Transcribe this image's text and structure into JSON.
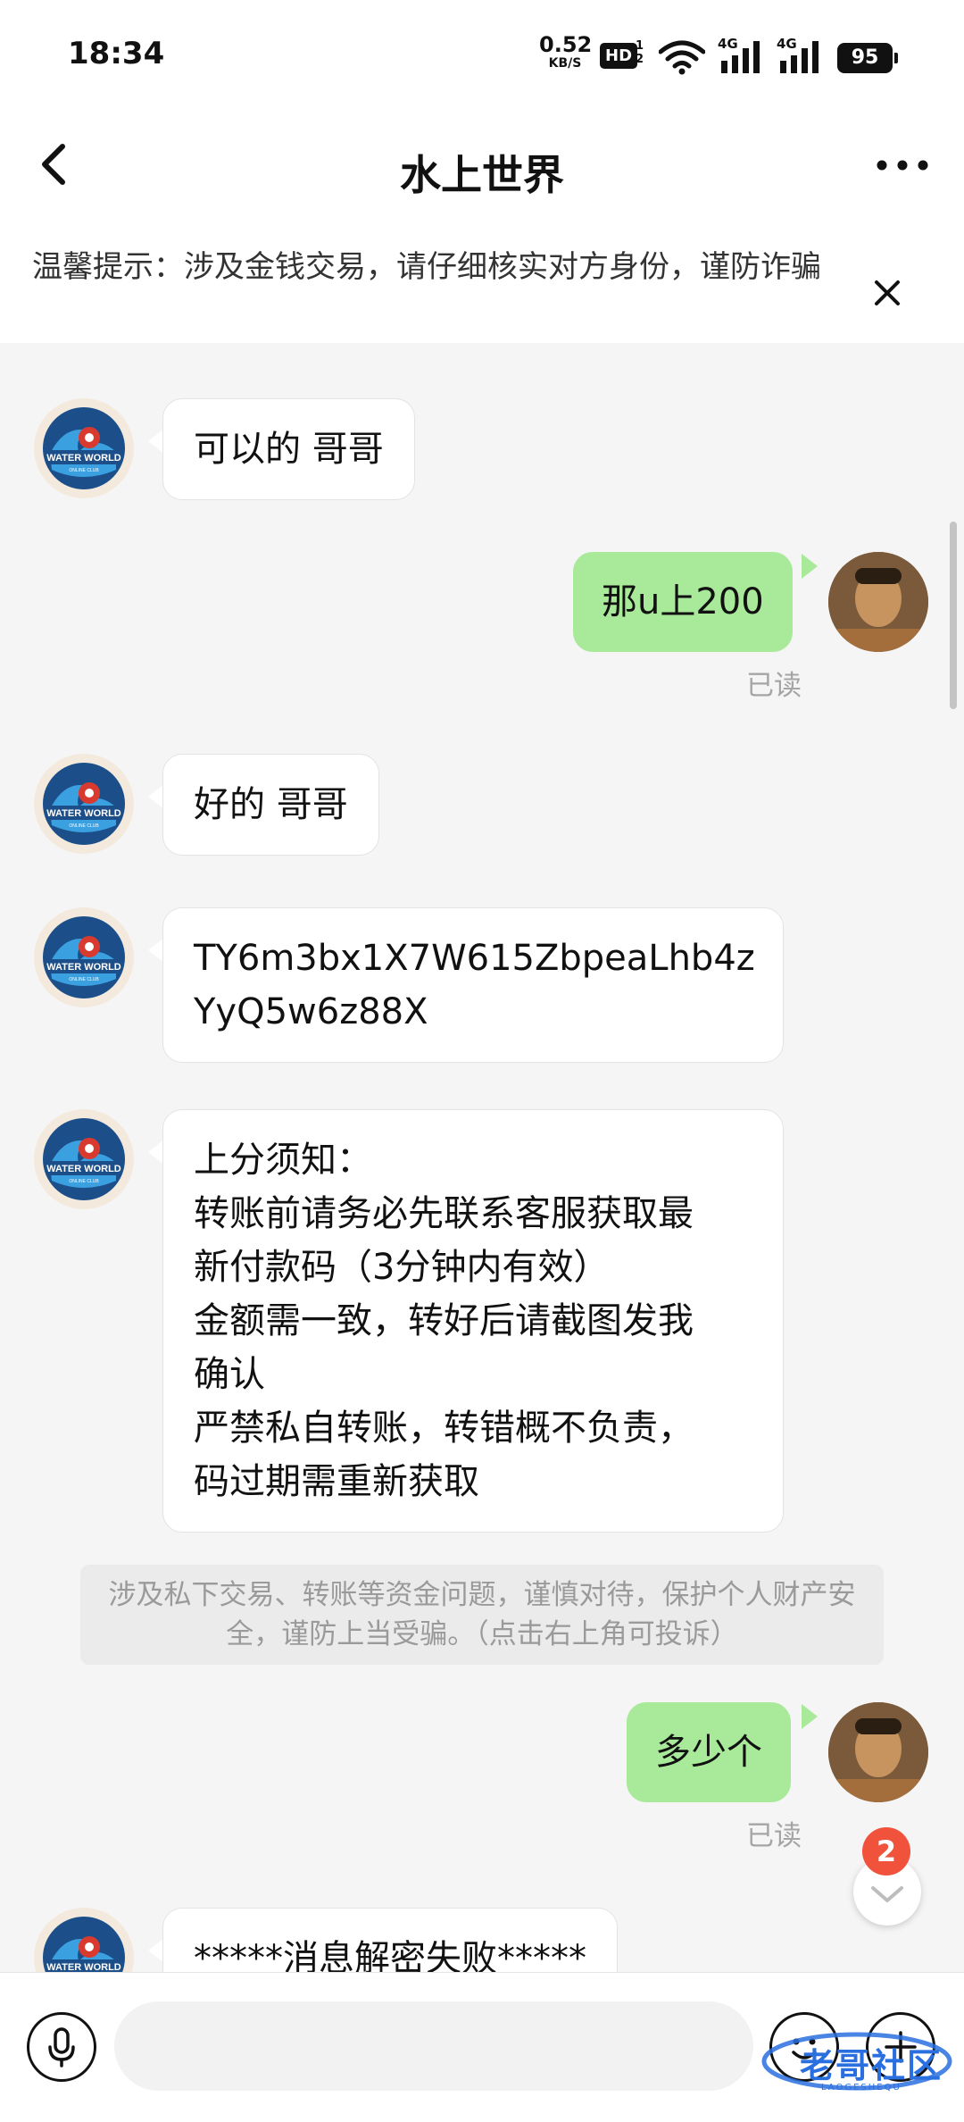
{
  "status_bar": {
    "time": "18:34",
    "net_speed": "0.52",
    "net_unit": "KB/S",
    "hd_label": "HD",
    "sim1_label": "4G",
    "sim2_label": "4G",
    "battery": "95"
  },
  "header": {
    "title": "水上世界",
    "back_icon": "chevron-left-icon",
    "more_icon": "more-horizontal-icon"
  },
  "notice": {
    "text": "温馨提示：涉及金钱交易，请仔细核实对方身份，谨防诈骗",
    "close_icon": "close-icon"
  },
  "bot_avatar": {
    "line1": "WATER WORLD",
    "line2": "ONLINE CLUB"
  },
  "messages": [
    {
      "side": "in",
      "text": "可以的 哥哥"
    },
    {
      "side": "out",
      "text": "那u上200",
      "status": "已读"
    },
    {
      "side": "in",
      "text": "好的 哥哥"
    },
    {
      "side": "in",
      "lines": [
        "TY6m3bx1X7W615ZbpeaLhb4z",
        "YyQ5w6z88X"
      ]
    },
    {
      "side": "in",
      "lines": [
        "上分须知：",
        "转账前请务必先联系客服获取最",
        "新付款码（3分钟内有效）",
        "金额需一致，转好后请截图发我",
        "确认",
        "严禁私自转账，转错概不负责，",
        "码过期需重新获取"
      ]
    },
    {
      "side": "system",
      "text": "涉及私下交易、转账等资金问题，谨慎对待，保护个人财产安全，谨防上当受骗。（点击右上角可投诉）"
    },
    {
      "side": "out",
      "text": "多少个",
      "status": "已读"
    },
    {
      "side": "in",
      "text": "*****消息解密失败*****"
    }
  ],
  "scroll_down": {
    "badge": "2",
    "icon": "chevron-down-icon"
  },
  "input_bar": {
    "placeholder": "",
    "mic_icon": "microphone-icon",
    "emoji_icon": "emoji-icon",
    "plus_icon": "plus-icon"
  },
  "watermark": {
    "text": "老哥社区",
    "sub": "LAOGESHEQU"
  },
  "colors": {
    "outgoing_bubble": "#a9e99a",
    "incoming_bubble": "#ffffff",
    "badge": "#f0523b",
    "background": "#f5f5f5"
  }
}
